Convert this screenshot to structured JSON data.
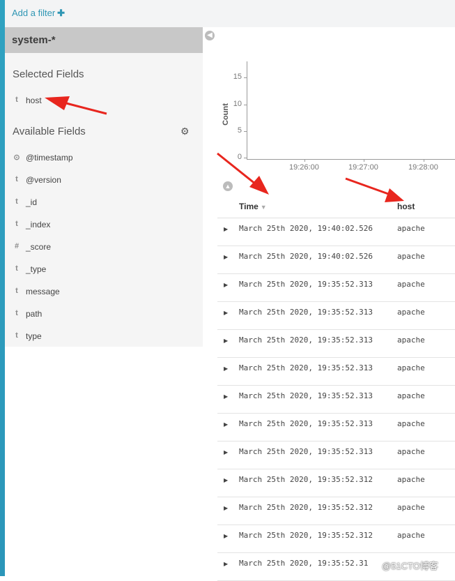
{
  "topbar": {
    "add_filter_label": "Add a filter",
    "add_filter_icon": "plus-icon"
  },
  "sidebar": {
    "index_pattern": "system-*",
    "selected_title": "Selected Fields",
    "selected_fields": [
      {
        "type": "t",
        "name": "host"
      }
    ],
    "available_title": "Available Fields",
    "available_fields": [
      {
        "type": "⊙",
        "name": "@timestamp"
      },
      {
        "type": "t",
        "name": "@version"
      },
      {
        "type": "t",
        "name": "_id"
      },
      {
        "type": "t",
        "name": "_index"
      },
      {
        "type": "#",
        "name": "_score"
      },
      {
        "type": "t",
        "name": "_type"
      },
      {
        "type": "t",
        "name": "message"
      },
      {
        "type": "t",
        "name": "path"
      },
      {
        "type": "t",
        "name": "type"
      }
    ]
  },
  "chart_data": {
    "type": "bar",
    "ylabel": "Count",
    "yticks": [
      "15",
      "10",
      "5",
      "0"
    ],
    "xticks": [
      "19:26:00",
      "19:27:00",
      "19:28:00"
    ]
  },
  "table": {
    "columns": [
      "Time",
      "host"
    ],
    "rows": [
      {
        "time": "March 25th 2020, 19:40:02.526",
        "host": "apache"
      },
      {
        "time": "March 25th 2020, 19:40:02.526",
        "host": "apache"
      },
      {
        "time": "March 25th 2020, 19:35:52.313",
        "host": "apache"
      },
      {
        "time": "March 25th 2020, 19:35:52.313",
        "host": "apache"
      },
      {
        "time": "March 25th 2020, 19:35:52.313",
        "host": "apache"
      },
      {
        "time": "March 25th 2020, 19:35:52.313",
        "host": "apache"
      },
      {
        "time": "March 25th 2020, 19:35:52.313",
        "host": "apache"
      },
      {
        "time": "March 25th 2020, 19:35:52.313",
        "host": "apache"
      },
      {
        "time": "March 25th 2020, 19:35:52.313",
        "host": "apache"
      },
      {
        "time": "March 25th 2020, 19:35:52.312",
        "host": "apache"
      },
      {
        "time": "March 25th 2020, 19:35:52.312",
        "host": "apache"
      },
      {
        "time": "March 25th 2020, 19:35:52.312",
        "host": "apache"
      },
      {
        "time": "March 25th 2020, 19:35:52.31",
        "host": ""
      }
    ]
  },
  "watermark": "@51CTO博客",
  "colors": {
    "accent": "#2f96b4",
    "stripe": "#2fa2c1",
    "annotation": "#e8261e"
  }
}
